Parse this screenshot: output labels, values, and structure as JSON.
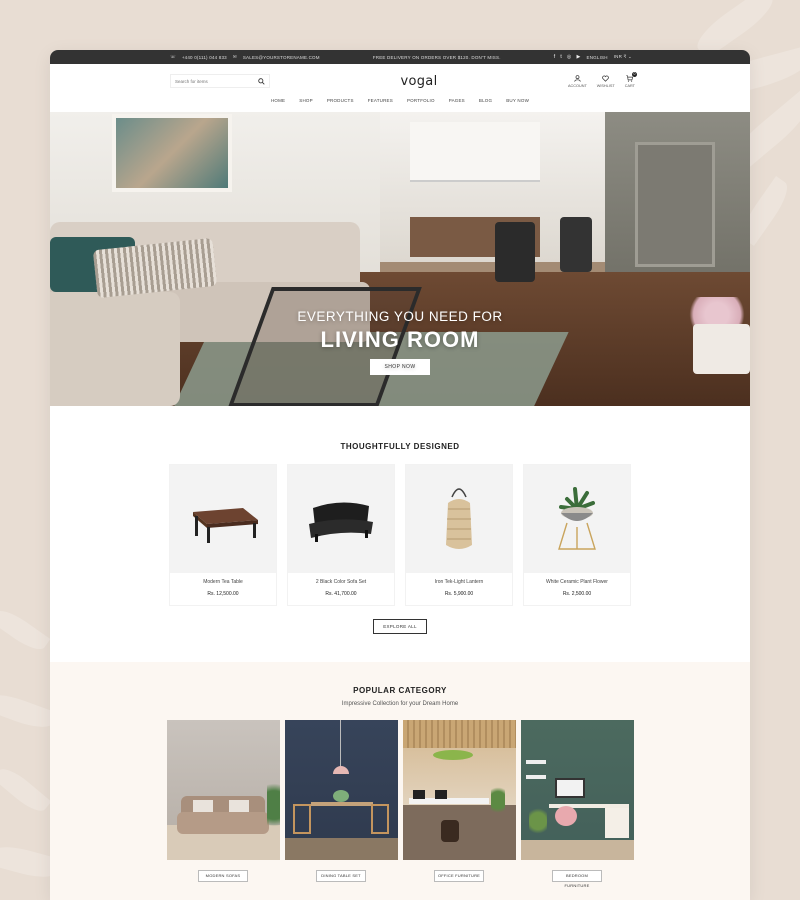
{
  "topbar": {
    "phone": "+440 0(111) 044 833",
    "email": "SALES@YOURSTORENAME.COM",
    "promo": "FREE DELIVERY ON ORDERS OVER $120. DON'T MISS.",
    "language": "ENGLISH",
    "currency": "INR ₹"
  },
  "header": {
    "search_placeholder": "Search for items",
    "logo": "vogal",
    "account_label": "ACCOUNT",
    "wishlist_label": "WISHLIST",
    "cart_label": "CART",
    "cart_count": "0"
  },
  "nav": [
    "HOME",
    "SHOP",
    "PRODUCTS",
    "FEATURES",
    "PORTFOLIO",
    "PAGES",
    "BLOG",
    "BUY NOW"
  ],
  "hero": {
    "subtitle": "EVERYTHING YOU NEED FOR",
    "title": "LIVING ROOM",
    "button": "SHOP NOW"
  },
  "featured": {
    "title": "THOUGHTFULLY DESIGNED",
    "products": [
      {
        "name": "Modern Tea Table",
        "price": "Rs. 12,500.00"
      },
      {
        "name": "2 Black Color Sofa Set",
        "price": "Rs. 41,700.00"
      },
      {
        "name": "Iron Tek-Light Lantern",
        "price": "Rs. 5,900.00"
      },
      {
        "name": "White Ceramic Plant Flower",
        "price": "Rs. 2,500.00"
      }
    ],
    "explore_label": "EXPLORE ALL"
  },
  "category": {
    "title": "POPULAR CATEGORY",
    "subtitle": "Impressive Collection for your Dream Home",
    "items": [
      {
        "label": "MODERN SOFAS"
      },
      {
        "label": "DINING TABLE SET"
      },
      {
        "label": "OFFICE FURNITURE"
      },
      {
        "label": "BEDROOM FURNITURE"
      }
    ]
  }
}
